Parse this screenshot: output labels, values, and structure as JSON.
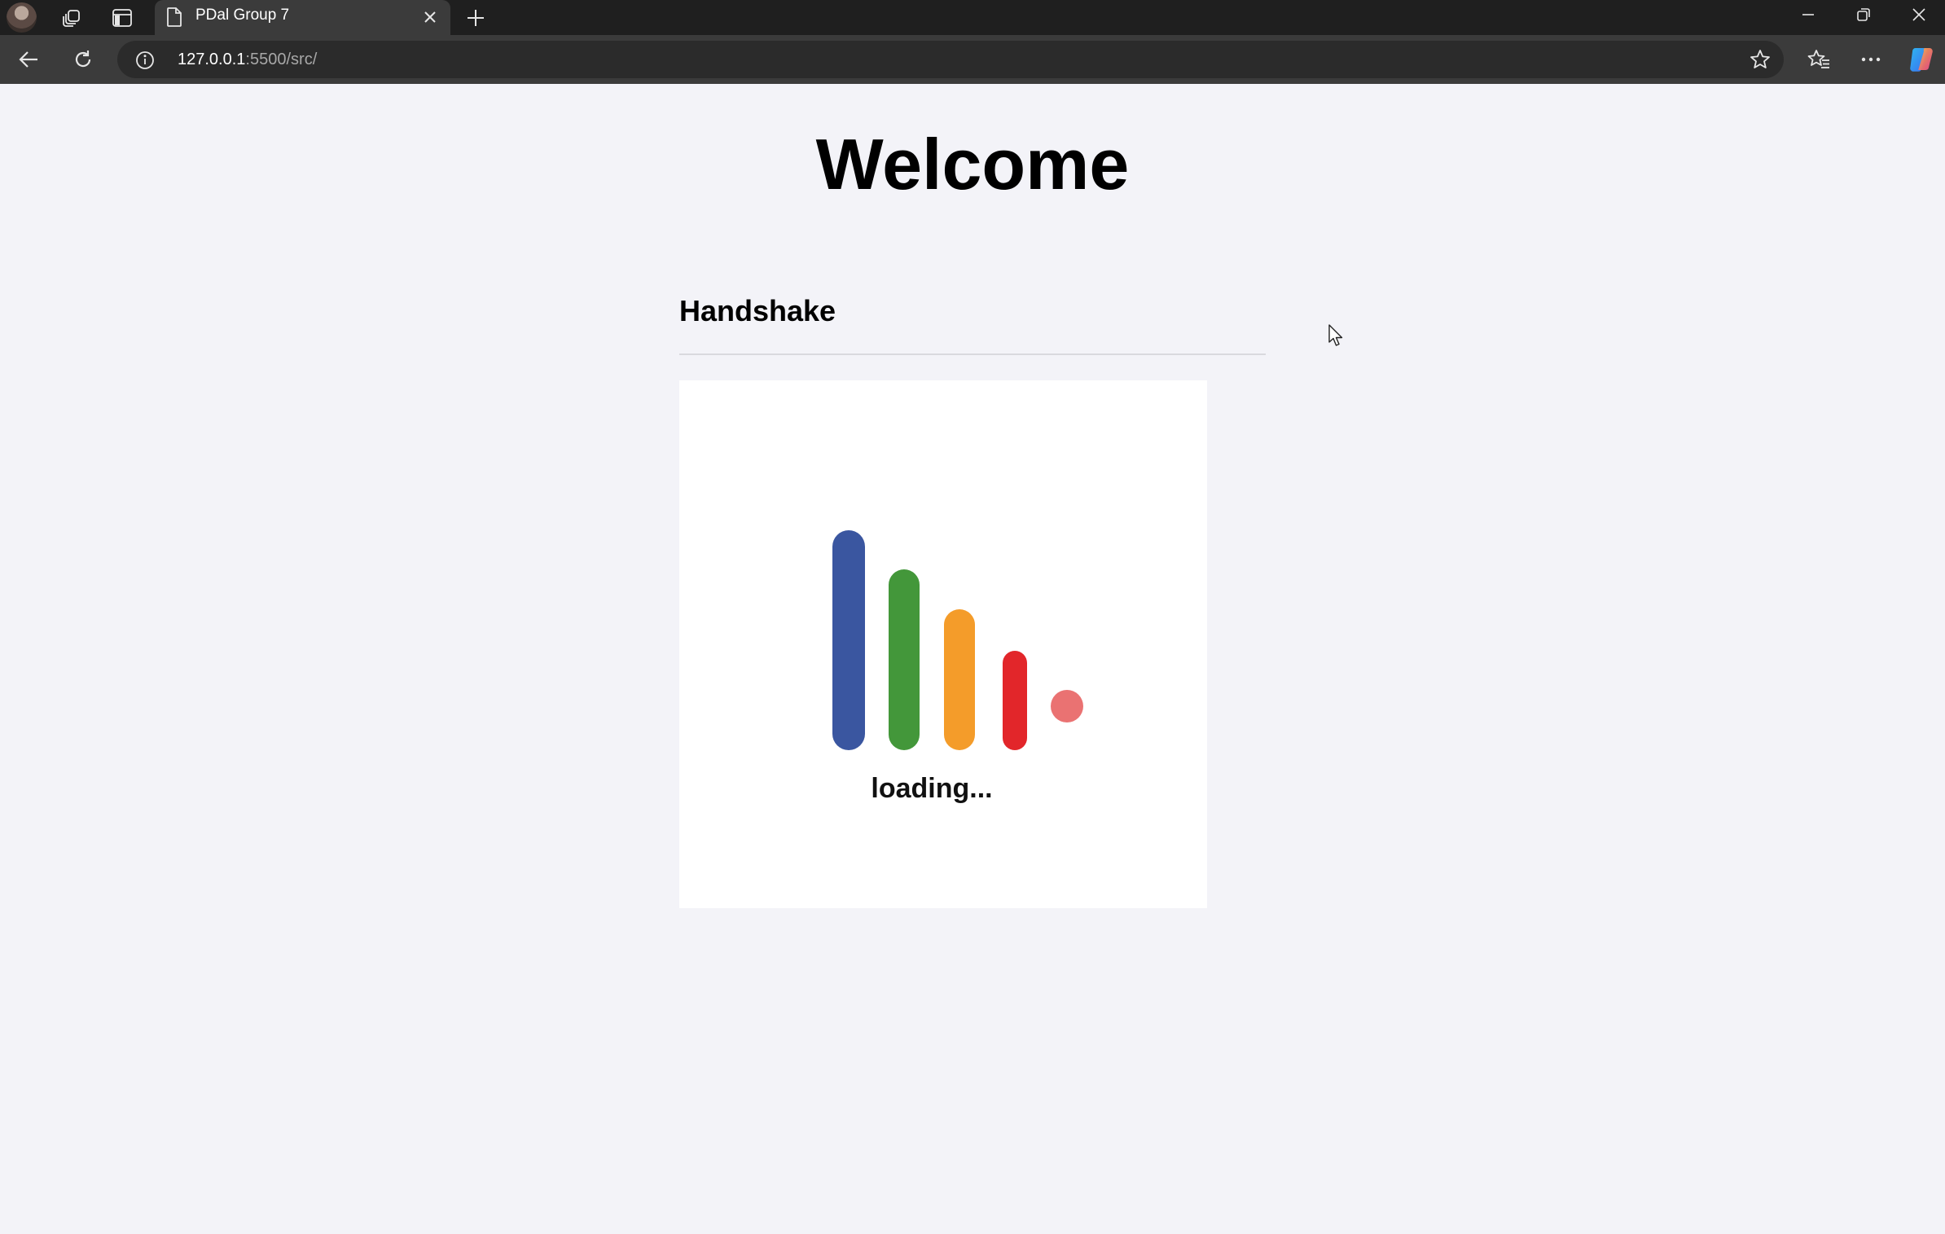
{
  "browser": {
    "tab": {
      "title": "PDal Group 7"
    },
    "address": {
      "host": "127.0.0.1",
      "path": ":5500/src/"
    },
    "icons": {
      "profile": "profile-avatar",
      "workspaces": "workspaces-icon",
      "tab_actions": "tab-actions-icon",
      "page": "page-icon",
      "close_tab": "close-icon",
      "new_tab": "plus-icon",
      "minimize": "minimize-icon",
      "restore": "restore-icon",
      "close_window": "close-icon",
      "back": "back-arrow-icon",
      "refresh": "refresh-icon",
      "site_info": "info-icon",
      "favorite": "star-icon",
      "favorites": "favorites-icon",
      "more": "more-icon",
      "copilot": "copilot-icon"
    }
  },
  "page": {
    "heading": "Welcome",
    "section_title": "Handshake",
    "loader": {
      "label": "loading...",
      "bars": [
        {
          "color": "#3a56a0"
        },
        {
          "color": "#43973a"
        },
        {
          "color": "#f49c2a"
        },
        {
          "color": "#e2262a"
        }
      ],
      "dot": {
        "color": "#ea7272"
      }
    }
  },
  "colors": {
    "page_background": "#f3f3f8",
    "chrome_dark": "#1f1f1f",
    "toolbar": "#3b3b3b"
  }
}
